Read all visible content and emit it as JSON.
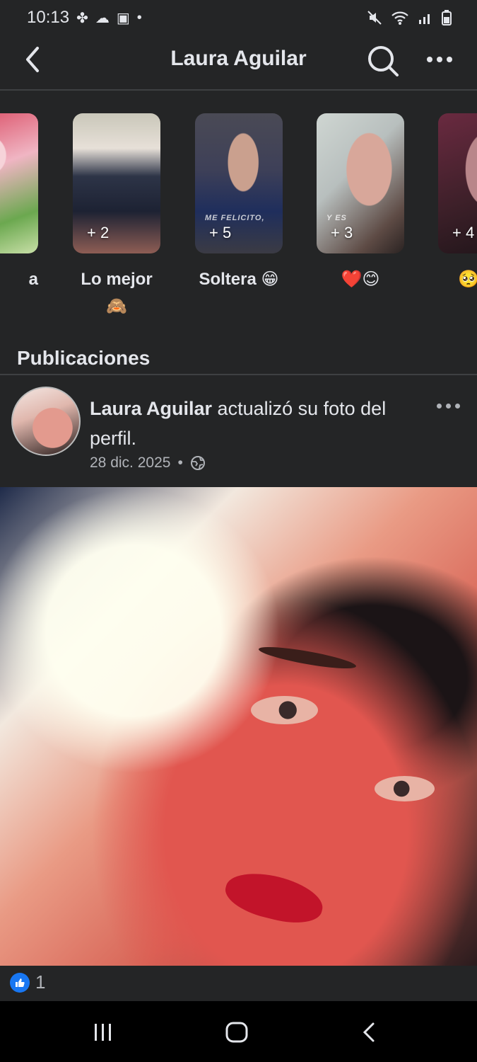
{
  "status_bar": {
    "time": "10:13"
  },
  "header": {
    "title": "Laura Aguilar"
  },
  "highlights": [
    {
      "label": "a",
      "count": ""
    },
    {
      "label": "Lo mejor 🙈",
      "count": "+ 2"
    },
    {
      "label": "Soltera 😁",
      "count": "+ 5",
      "caption": "ME FELICITO,"
    },
    {
      "label": "❤️😊",
      "count": "+ 3",
      "caption": "Y ES"
    },
    {
      "label": "🥺",
      "count": "+ 4"
    }
  ],
  "section": {
    "title": "Publicaciones"
  },
  "post": {
    "author": "Laura Aguilar",
    "action": " actualizó su foto del perfil.",
    "date": "28 dic. 2025",
    "separator": "•",
    "likes": "1"
  },
  "icons": {
    "back": "back-arrow-icon",
    "search": "search-icon",
    "more": "more-icon",
    "globe": "globe-icon",
    "like": "like-icon"
  },
  "colors": {
    "background": "#242526",
    "like_blue": "#1877f2"
  }
}
